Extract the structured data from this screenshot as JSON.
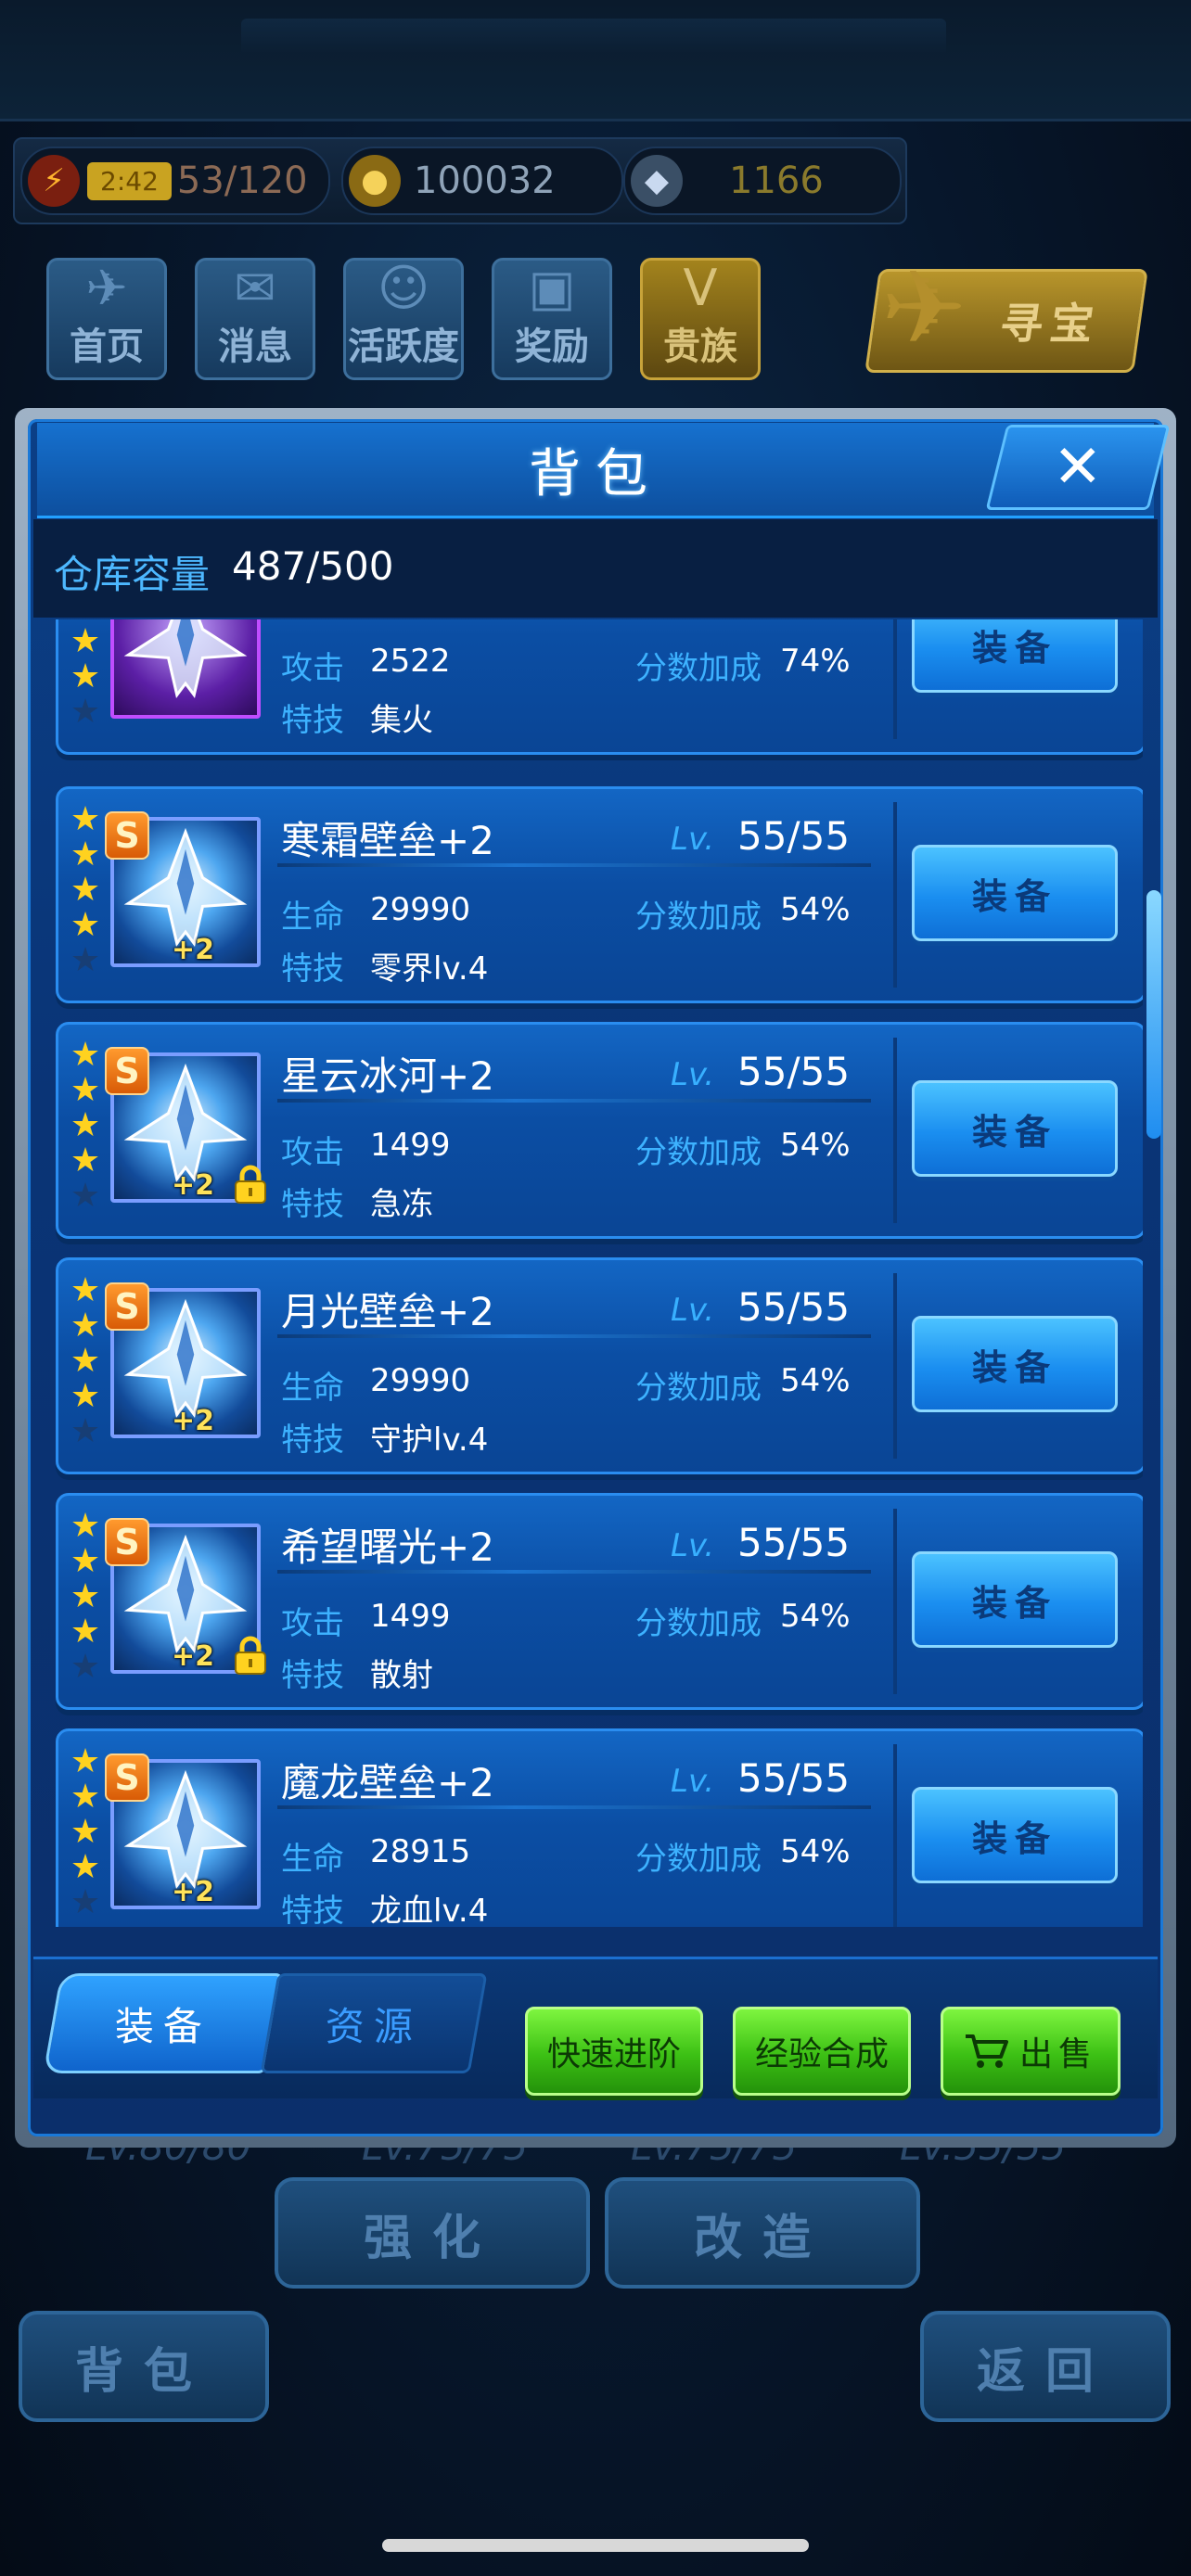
{
  "hud": {
    "energy": {
      "icon": "lightning-icon",
      "timer": "2:42",
      "value": "53/120"
    },
    "gold": {
      "icon": "coin-icon",
      "value": "100032"
    },
    "diamond": {
      "icon": "diamond-icon",
      "value": "1166"
    }
  },
  "nav": [
    {
      "label": "首页",
      "icon": "jet-icon"
    },
    {
      "label": "消息",
      "icon": "mail-icon"
    },
    {
      "label": "活跃度",
      "icon": "medal-icon"
    },
    {
      "label": "奖励",
      "icon": "gift-icon"
    },
    {
      "label": "贵族",
      "icon": "vip-shield-icon"
    }
  ],
  "treasure_label": "寻宝",
  "background_levels": [
    "80/80",
    "75/75",
    "75/75",
    "55/55"
  ],
  "background_level_tag": "Lv.",
  "background_buttons": {
    "enhance": "强化",
    "modify": "改造",
    "bag": "背包",
    "back": "返回"
  },
  "dialog": {
    "title": "背包",
    "close_icon": "close-icon",
    "capacity_label": "仓库容量",
    "capacity_value": "487/500"
  },
  "items": [
    {
      "name": "",
      "level": "",
      "stars": 4,
      "stat1_label": "攻击",
      "stat1_value": "2522",
      "bonus_label": "分数加成",
      "bonus_value": "74%",
      "skill_label": "特技",
      "skill_value": "集火",
      "rarity": "",
      "plus": "",
      "locked": false,
      "frame": "purple",
      "equip_label": "装备"
    },
    {
      "name": "寒霜壁垒+2",
      "level": "55/55",
      "stars": 4,
      "stat1_label": "生命",
      "stat1_value": "29990",
      "bonus_label": "分数加成",
      "bonus_value": "54%",
      "skill_label": "特技",
      "skill_value": "零界lv.4",
      "rarity": "S",
      "plus": "+2",
      "locked": false,
      "frame": "blue",
      "equip_label": "装备"
    },
    {
      "name": "星云冰河+2",
      "level": "55/55",
      "stars": 4,
      "stat1_label": "攻击",
      "stat1_value": "1499",
      "bonus_label": "分数加成",
      "bonus_value": "54%",
      "skill_label": "特技",
      "skill_value": "急冻",
      "rarity": "S",
      "plus": "+2",
      "locked": true,
      "frame": "blue",
      "equip_label": "装备"
    },
    {
      "name": "月光壁垒+2",
      "level": "55/55",
      "stars": 4,
      "stat1_label": "生命",
      "stat1_value": "29990",
      "bonus_label": "分数加成",
      "bonus_value": "54%",
      "skill_label": "特技",
      "skill_value": "守护lv.4",
      "rarity": "S",
      "plus": "+2",
      "locked": false,
      "frame": "blue",
      "equip_label": "装备"
    },
    {
      "name": "希望曙光+2",
      "level": "55/55",
      "stars": 4,
      "stat1_label": "攻击",
      "stat1_value": "1499",
      "bonus_label": "分数加成",
      "bonus_value": "54%",
      "skill_label": "特技",
      "skill_value": "散射",
      "rarity": "S",
      "plus": "+2",
      "locked": true,
      "frame": "blue",
      "equip_label": "装备"
    },
    {
      "name": "魔龙壁垒+2",
      "level": "55/55",
      "stars": 4,
      "stat1_label": "生命",
      "stat1_value": "28915",
      "bonus_label": "分数加成",
      "bonus_value": "54%",
      "skill_label": "特技",
      "skill_value": "龙血lv.4",
      "rarity": "S",
      "plus": "+2",
      "locked": false,
      "frame": "blue",
      "equip_label": "装备"
    }
  ],
  "lv_tag": "Lv.",
  "tabs": {
    "equipment": "装备",
    "resources": "资源"
  },
  "actions": {
    "quick_advance": "快速进阶",
    "exp_merge": "经验合成",
    "sell": "出售",
    "sell_icon": "cart-icon"
  }
}
